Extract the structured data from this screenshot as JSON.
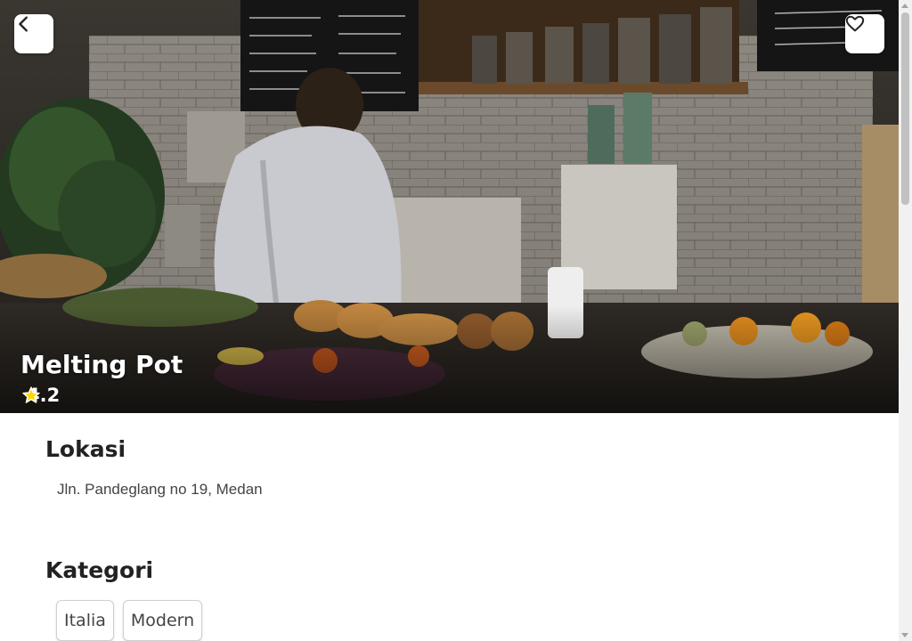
{
  "restaurant": {
    "name": "Melting Pot",
    "rating": 4.2,
    "rating_label": "4.2",
    "hero_image": "cafe-counter-photo"
  },
  "actions": {
    "back_icon": "chevron-left-icon",
    "favorite_icon": "heart-outline-icon"
  },
  "location": {
    "heading": "Lokasi",
    "address": "Jln. Pandeglang no 19, Medan"
  },
  "category": {
    "heading": "Kategori",
    "chips": [
      "Italia",
      "Modern"
    ]
  },
  "colors": {
    "star": "#ffd700",
    "background": "#ffffff",
    "text": "#222222"
  }
}
